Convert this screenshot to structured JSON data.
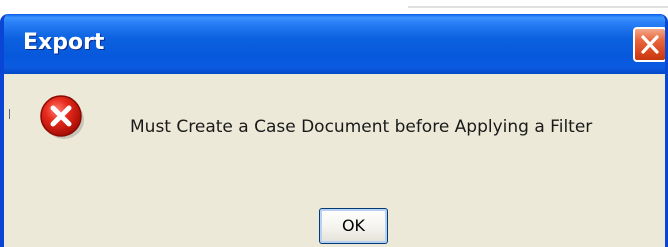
{
  "dialog": {
    "title": "Export",
    "message": "Must Create a Case Document before Applying a Filter",
    "ok_label": "OK",
    "icon": "error-icon",
    "close_icon": "close-icon"
  },
  "colors": {
    "titlebar": "#0758dc",
    "body": "#ece9d8",
    "close_button": "#d8461c",
    "error_icon": "#e0140f"
  }
}
